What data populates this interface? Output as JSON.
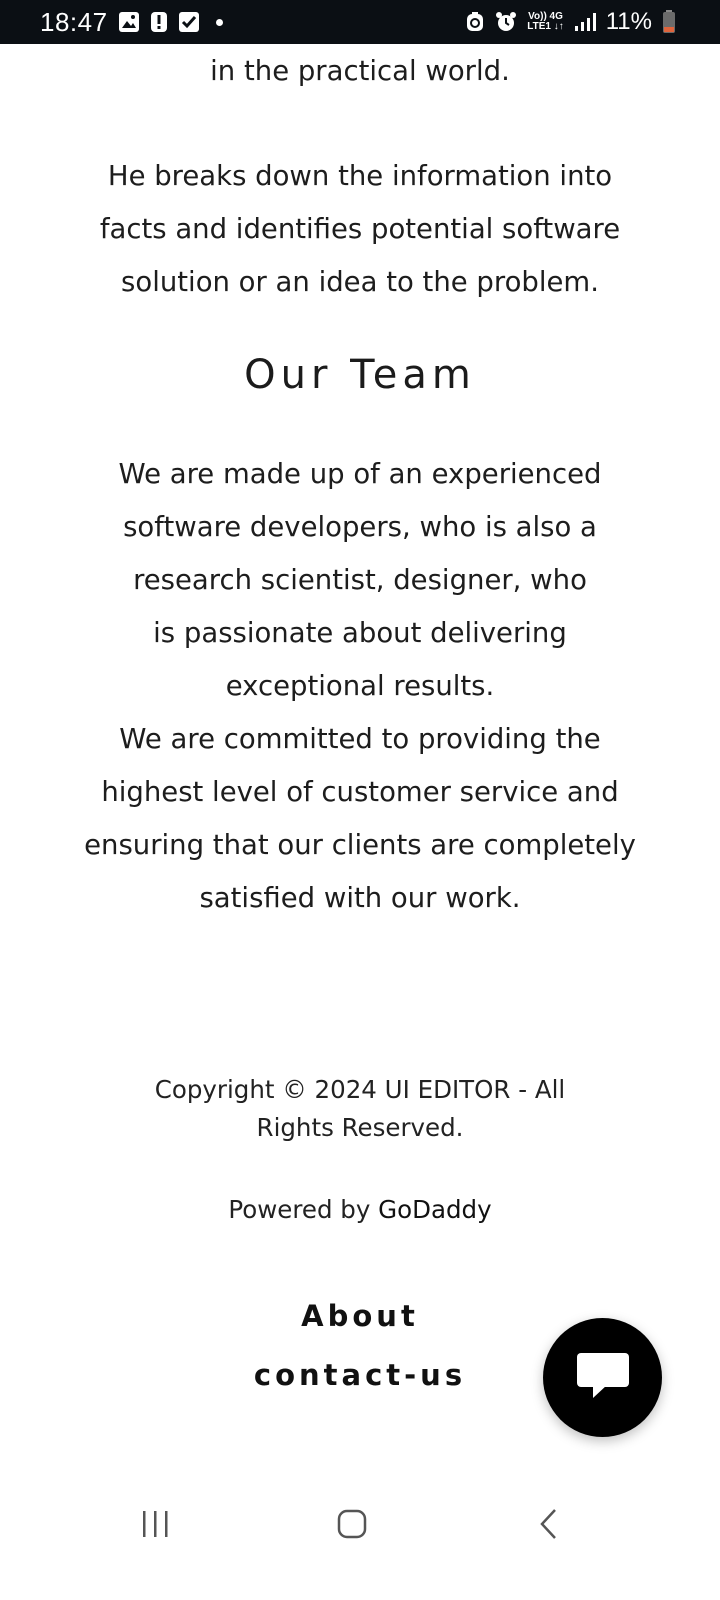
{
  "status_bar": {
    "time": "18:47",
    "network_top": "Vo)) 4G",
    "network_bottom": "LTE1 ↓↑",
    "battery": "11%",
    "icons": [
      "image-icon",
      "alert-icon",
      "check-icon",
      "dot-icon",
      "data-saver-icon",
      "alarm-icon",
      "signal-icon",
      "battery-icon"
    ]
  },
  "content": {
    "intro_tail": "in the practical world.",
    "para_breakdown": [
      "He breaks down the information into",
      "facts and identifies potential software",
      "solution or an idea to the problem."
    ],
    "team_heading": "Our Team",
    "para_team": [
      "We are made up of an experienced",
      "software developers, who is also a",
      "research scientist, designer, who",
      "is passionate about delivering",
      "exceptional results.",
      "We are committed to providing the",
      "highest level of customer service and",
      "ensuring that our clients are completely",
      "satisfied with our work."
    ]
  },
  "footer": {
    "copyright_line1": "Copyright © 2024 UI EDITOR - All",
    "copyright_line2": "Rights Reserved.",
    "powered_prefix": "Powered by ",
    "powered_link": "GoDaddy",
    "links": [
      "About",
      "contact-us"
    ]
  },
  "chat": {
    "icon": "chat-bubble-icon"
  },
  "nav": {
    "icons": [
      "recent-apps-icon",
      "home-icon",
      "back-icon"
    ]
  }
}
